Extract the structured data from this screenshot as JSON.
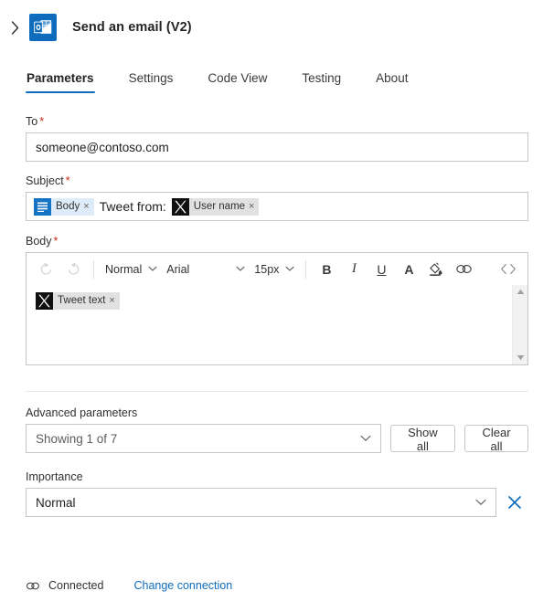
{
  "header": {
    "expand_icon": "chevron-right-icon",
    "app_icon": "outlook-icon",
    "title": "Send an email (V2)"
  },
  "tabs": [
    {
      "label": "Parameters",
      "active": true
    },
    {
      "label": "Settings",
      "active": false
    },
    {
      "label": "Code View",
      "active": false
    },
    {
      "label": "Testing",
      "active": false
    },
    {
      "label": "About",
      "active": false
    }
  ],
  "fields": {
    "to": {
      "label": "To",
      "required_marker": "*",
      "value": "someone@contoso.com"
    },
    "subject": {
      "label": "Subject",
      "required_marker": "*",
      "tokens": [
        {
          "icon": "body-list-icon",
          "label": "Body",
          "remove": "×"
        },
        {
          "icon": "x-twitter-icon",
          "label": "User name",
          "remove": "×"
        }
      ],
      "static_text": "Tweet from:"
    },
    "body": {
      "label": "Body",
      "required_marker": "*",
      "toolbar": {
        "undo": "undo-icon",
        "redo": "redo-icon",
        "style": "Normal",
        "font": "Arial",
        "size": "15px",
        "bold": "B",
        "italic": "I",
        "underline": "U",
        "font_color": "A",
        "highlight": "highlight-icon",
        "link": "link-icon",
        "code": "<>"
      },
      "token": {
        "icon": "x-twitter-icon",
        "label": "Tweet text",
        "remove": "×"
      }
    }
  },
  "advanced": {
    "label": "Advanced parameters",
    "dropdown_value": "Showing 1 of 7",
    "show_all_label": "Show all",
    "clear_all_label": "Clear all"
  },
  "importance": {
    "label": "Importance",
    "value": "Normal",
    "clear_icon": "close-icon"
  },
  "footer": {
    "status_icon": "link-connected-icon",
    "status_text": "Connected",
    "change_link": "Change connection"
  },
  "colors": {
    "accent": "#0f6cbd",
    "required": "#c42b1c",
    "border": "#c8c6c4",
    "token_body_bg": "#deecf9",
    "token_x_bg": "#e1e1e1"
  }
}
